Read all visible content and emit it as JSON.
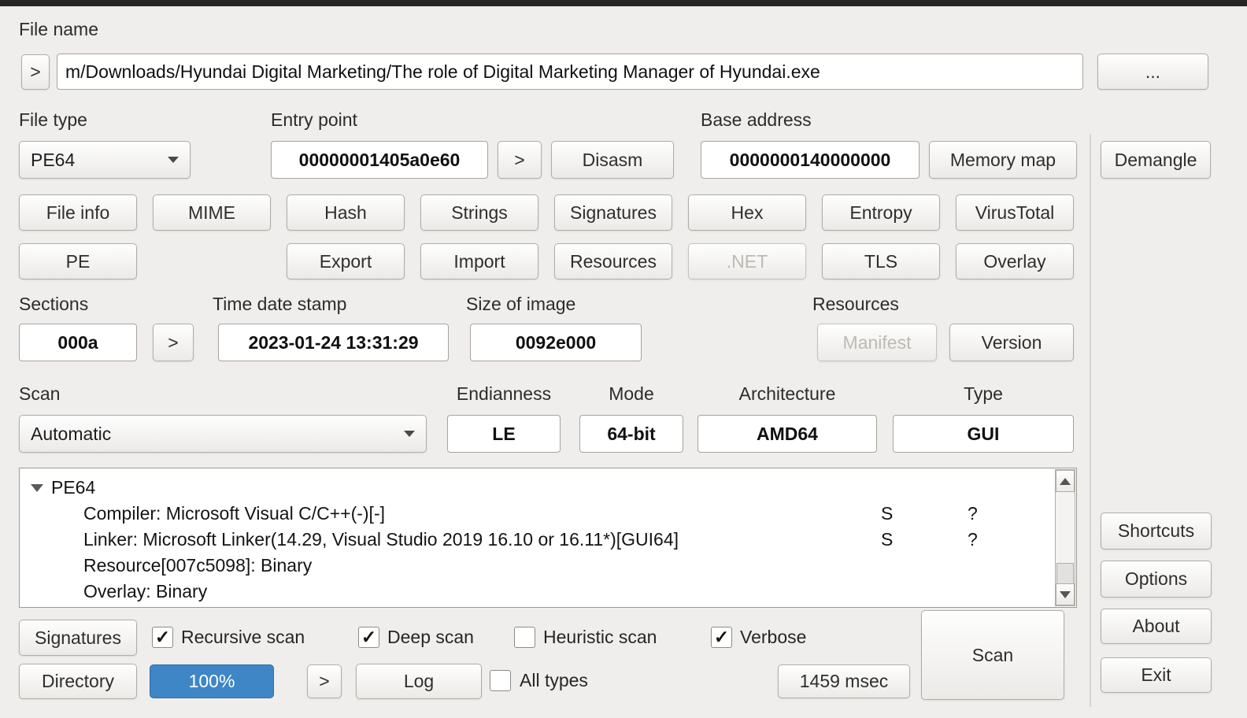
{
  "colors": {
    "accent_progress": "#3e86c6",
    "window_bg": "#efeeec"
  },
  "file_name": {
    "label": "File name",
    "expand": ">",
    "value": "m/Downloads/Hyundai Digital Marketing/The role of Digital Marketing Manager of Hyundai.exe",
    "browse": "..."
  },
  "file_type": {
    "label": "File type",
    "value": "PE64"
  },
  "entry_point": {
    "label": "Entry point",
    "value": "00000001405a0e60",
    "follow": ">",
    "disasm": "Disasm"
  },
  "base_address": {
    "label": "Base address",
    "value": "0000000140000000",
    "memory_map": "Memory map"
  },
  "demangle_label": "Demangle",
  "tools_row1": [
    {
      "label": "File info",
      "enabled": true
    },
    {
      "label": "MIME",
      "enabled": true
    },
    {
      "label": "Hash",
      "enabled": true
    },
    {
      "label": "Strings",
      "enabled": true
    },
    {
      "label": "Signatures",
      "enabled": true
    },
    {
      "label": "Hex",
      "enabled": true
    },
    {
      "label": "Entropy",
      "enabled": true
    },
    {
      "label": "VirusTotal",
      "enabled": true
    }
  ],
  "tools_row2": [
    {
      "label": "PE",
      "enabled": true
    },
    {
      "label": "Export",
      "enabled": true
    },
    {
      "label": "Import",
      "enabled": true
    },
    {
      "label": "Resources",
      "enabled": true
    },
    {
      "label": ".NET",
      "enabled": false
    },
    {
      "label": "TLS",
      "enabled": true
    },
    {
      "label": "Overlay",
      "enabled": true
    }
  ],
  "sections": {
    "label": "Sections",
    "value": "000a",
    "expand": ">"
  },
  "time_date_stamp": {
    "label": "Time date stamp",
    "value": "2023-01-24 13:31:29"
  },
  "size_of_image": {
    "label": "Size of image",
    "value": "0092e000"
  },
  "resources": {
    "label": "Resources",
    "manifest": {
      "label": "Manifest",
      "enabled": false
    },
    "version": {
      "label": "Version",
      "enabled": true
    }
  },
  "scan": {
    "label": "Scan",
    "method": "Automatic"
  },
  "endianness": {
    "label": "Endianness",
    "value": "LE"
  },
  "mode": {
    "label": "Mode",
    "value": "64-bit"
  },
  "architecture": {
    "label": "Architecture",
    "value": "AMD64"
  },
  "file_kind": {
    "label": "Type",
    "value": "GUI"
  },
  "results": {
    "root": "PE64",
    "rows": [
      {
        "text": "Compiler: Microsoft Visual C/C++(-)[-]",
        "s": "S",
        "q": "?"
      },
      {
        "text": "Linker: Microsoft Linker(14.29, Visual Studio 2019 16.10 or 16.11*)[GUI64]",
        "s": "S",
        "q": "?"
      },
      {
        "text": "Resource[007c5098]: Binary",
        "s": "",
        "q": ""
      },
      {
        "text": "Overlay: Binary",
        "s": "",
        "q": ""
      }
    ]
  },
  "scan_options": {
    "signatures": "Signatures",
    "recursive_scan": {
      "label": "Recursive scan",
      "checked": true,
      "mark": "✓"
    },
    "deep_scan": {
      "label": "Deep scan",
      "checked": true,
      "mark": "✓"
    },
    "heuristic_scan": {
      "label": "Heuristic scan",
      "checked": false,
      "mark": ""
    },
    "verbose": {
      "label": "Verbose",
      "checked": true,
      "mark": "✓"
    }
  },
  "bottom_bar": {
    "directory": "Directory",
    "progress": {
      "value": "100%"
    },
    "expand": ">",
    "log": "Log",
    "all_types": {
      "label": "All types",
      "checked": false,
      "mark": ""
    },
    "elapsed": "1459 msec",
    "scan_button": "Scan"
  },
  "side_panel": {
    "shortcuts": "Shortcuts",
    "options": "Options",
    "about": "About",
    "exit": "Exit"
  }
}
